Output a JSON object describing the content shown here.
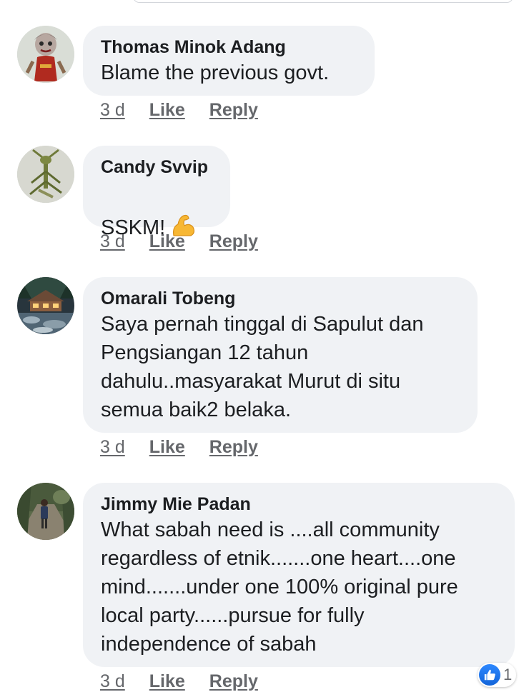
{
  "comments": [
    {
      "author": "Thomas Minok Adang",
      "text": "Blame the previous govt.",
      "time": "3 d",
      "like_label": "Like",
      "reply_label": "Reply",
      "avatar": "puppet-figure-avatar"
    },
    {
      "author": "Candy Svvip",
      "text": "SSKM!",
      "emoji": "flexed-biceps-icon",
      "time": "3 d",
      "like_label": "Like",
      "reply_label": "Reply",
      "avatar": "mantis-avatar"
    },
    {
      "author": "Omarali Tobeng",
      "text": "Saya pernah tinggal di Sapulut dan\nPengsiangan 12 tahun\ndahulu..masyarakat Murut di situ\nsemua baik2 belaka.",
      "time": "3 d",
      "like_label": "Like",
      "reply_label": "Reply",
      "avatar": "lodge-by-river-avatar"
    },
    {
      "author": "Jimmy Mie Padan",
      "text": "What sabah need is ....all community\nregardless of etnik.......one heart....one\nmind.......under one 100% original pure\nlocal party......pursue for fully\nindependence of sabah",
      "time": "3 d",
      "like_label": "Like",
      "reply_label": "Reply",
      "avatar": "person-on-trail-avatar",
      "reactions": {
        "icon": "thumbs-up-icon",
        "count": "1"
      }
    }
  ],
  "colors": {
    "bubble": "#f0f2f5",
    "text": "#1c1e21",
    "meta": "#65676b",
    "like_blue": "#1877f2"
  }
}
